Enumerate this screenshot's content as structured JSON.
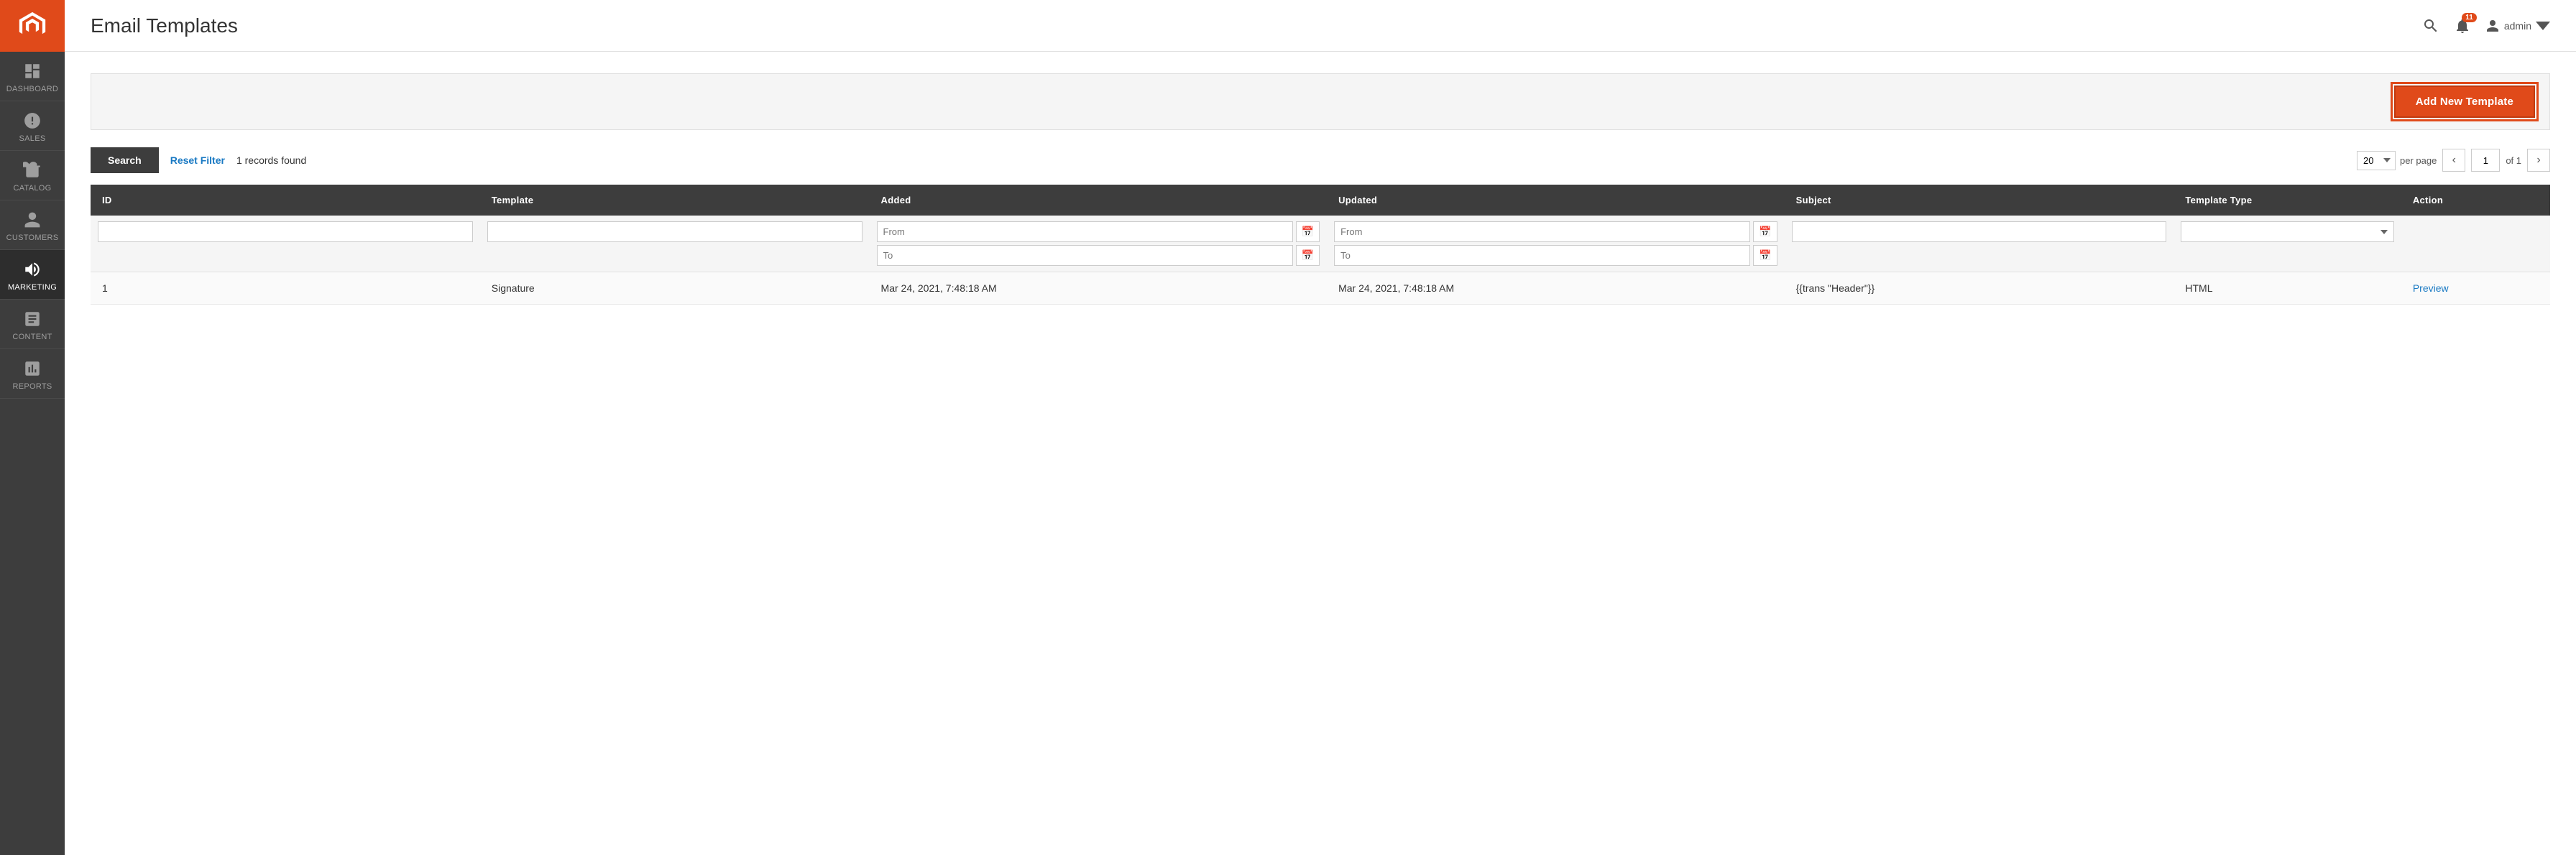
{
  "sidebar": {
    "logo_alt": "Magento Logo",
    "items": [
      {
        "id": "dashboard",
        "label": "Dashboard",
        "icon": "dashboard-icon"
      },
      {
        "id": "sales",
        "label": "Sales",
        "icon": "sales-icon"
      },
      {
        "id": "catalog",
        "label": "Catalog",
        "icon": "catalog-icon"
      },
      {
        "id": "customers",
        "label": "Customers",
        "icon": "customers-icon"
      },
      {
        "id": "marketing",
        "label": "Marketing",
        "icon": "marketing-icon",
        "active": true
      },
      {
        "id": "content",
        "label": "Content",
        "icon": "content-icon"
      },
      {
        "id": "reports",
        "label": "Reports",
        "icon": "reports-icon"
      }
    ]
  },
  "header": {
    "title": "Email Templates",
    "notification_count": "11",
    "user_name": "admin"
  },
  "toolbar": {
    "add_button_label": "Add New Template"
  },
  "filter": {
    "search_label": "Search",
    "reset_label": "Reset Filter",
    "records_found": "1 records found",
    "per_page_value": "20",
    "per_page_label": "per page",
    "page_current": "1",
    "page_of": "of 1"
  },
  "table": {
    "columns": [
      {
        "id": "id",
        "label": "ID"
      },
      {
        "id": "template",
        "label": "Template"
      },
      {
        "id": "added",
        "label": "Added"
      },
      {
        "id": "updated",
        "label": "Updated"
      },
      {
        "id": "subject",
        "label": "Subject"
      },
      {
        "id": "template_type",
        "label": "Template Type"
      },
      {
        "id": "action",
        "label": "Action"
      }
    ],
    "filter_placeholders": {
      "added_from": "From",
      "added_to": "To",
      "updated_from": "From",
      "updated_to": "To"
    },
    "rows": [
      {
        "id": "1",
        "template": "Signature",
        "added": "Mar 24, 2021, 7:48:18 AM",
        "updated": "Mar 24, 2021, 7:48:18 AM",
        "subject": "{{trans \"Header\"}}",
        "template_type": "HTML",
        "action_label": "Preview"
      }
    ]
  }
}
